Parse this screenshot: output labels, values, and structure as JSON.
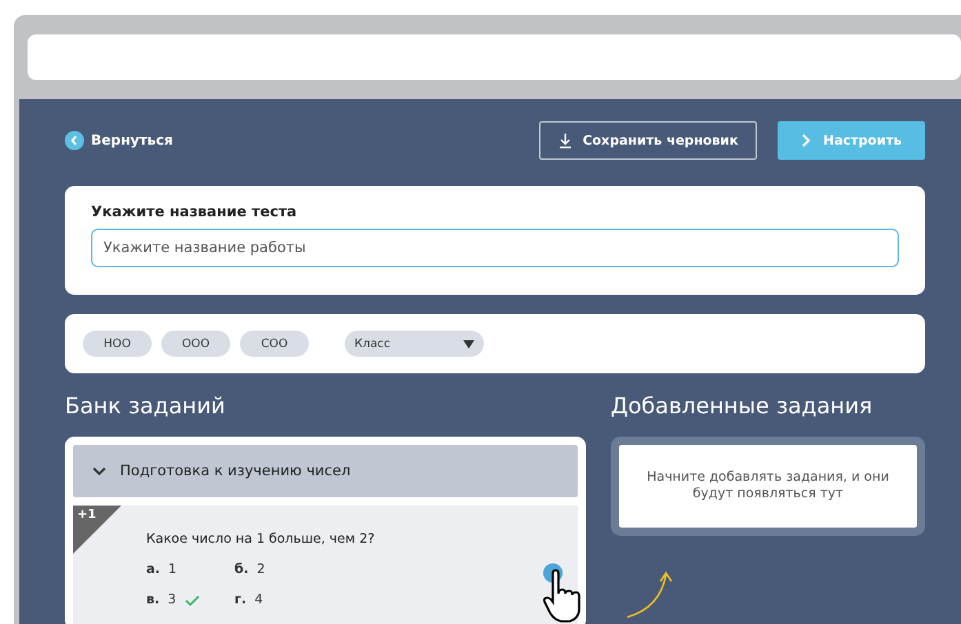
{
  "toolbar": {
    "back": "Вернуться",
    "save_draft": "Сохранить черновик",
    "configure": "Настроить"
  },
  "title_card": {
    "label": "Укажите название теста",
    "placeholder": "Укажите название работы"
  },
  "filters": {
    "chips": [
      "НОО",
      "ООО",
      "СОО"
    ],
    "dropdown": "Класс"
  },
  "bank": {
    "heading": "Банк заданий",
    "category": {
      "label": "Подготовка к изучению чисел",
      "expanded": true
    },
    "task": {
      "badge": "+1",
      "question": "Какое число на 1 больше, чем 2?",
      "answers": [
        {
          "letter": "а.",
          "text": "1",
          "correct": false
        },
        {
          "letter": "б.",
          "text": "2",
          "correct": false
        },
        {
          "letter": "в.",
          "text": "3",
          "correct": true
        },
        {
          "letter": "г.",
          "text": "4",
          "correct": false
        }
      ]
    }
  },
  "added": {
    "heading": "Добавленные задания",
    "empty_text": "Начните добавлять задания, и они будут появляться тут"
  }
}
